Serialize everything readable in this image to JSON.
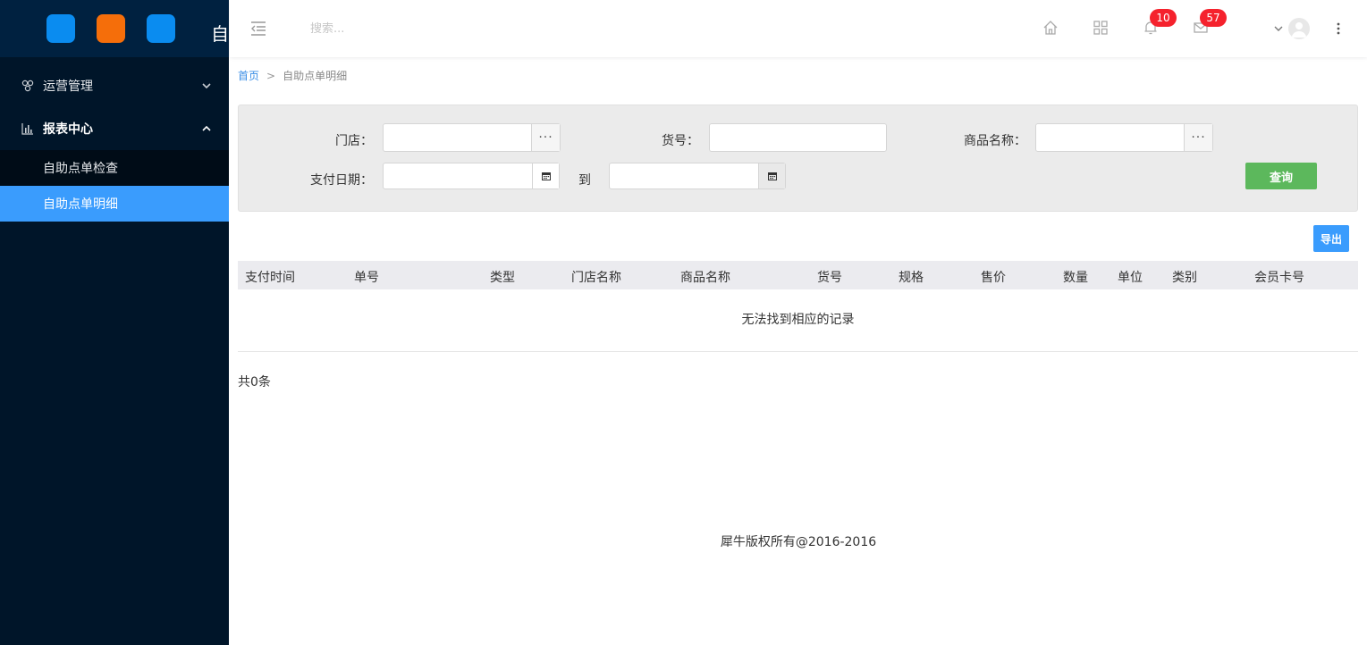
{
  "sidebar": {
    "brand": "自",
    "menu": [
      {
        "label": "运营管理",
        "icon": "cluster-icon",
        "expanded": false
      },
      {
        "label": "报表中心",
        "icon": "bar-chart-icon",
        "expanded": true,
        "children": [
          {
            "label": "自助点单检查",
            "active": false
          },
          {
            "label": "自助点单明细",
            "active": true
          }
        ]
      }
    ]
  },
  "header": {
    "search_placeholder": "搜索...",
    "notifications_count": "10",
    "messages_count": "57"
  },
  "breadcrumb": {
    "home": "首页",
    "separator": ">",
    "current": "自助点单明细"
  },
  "filter": {
    "store_label": "门店：",
    "item_no_label": "货号：",
    "product_name_label": "商品名称：",
    "pay_date_label": "支付日期：",
    "to_label": "到",
    "more_glyph": "···",
    "query_button": "查询"
  },
  "toolbar": {
    "export_button": "导出"
  },
  "table": {
    "columns": [
      "支付时间",
      "单号",
      "类型",
      "门店名称",
      "商品名称",
      "货号",
      "规格",
      "售价",
      "数量",
      "单位",
      "类别",
      "会员卡号"
    ],
    "empty_text": "无法找到相应的记录",
    "total_text": "共0条"
  },
  "footer": {
    "copyright": "犀牛版权所有@2016-2016"
  },
  "colors": {
    "sidebar_bg": "#001529",
    "active_menu": "#3a9cfd",
    "query_button": "#5cb85c",
    "badge": "#f5222d"
  }
}
